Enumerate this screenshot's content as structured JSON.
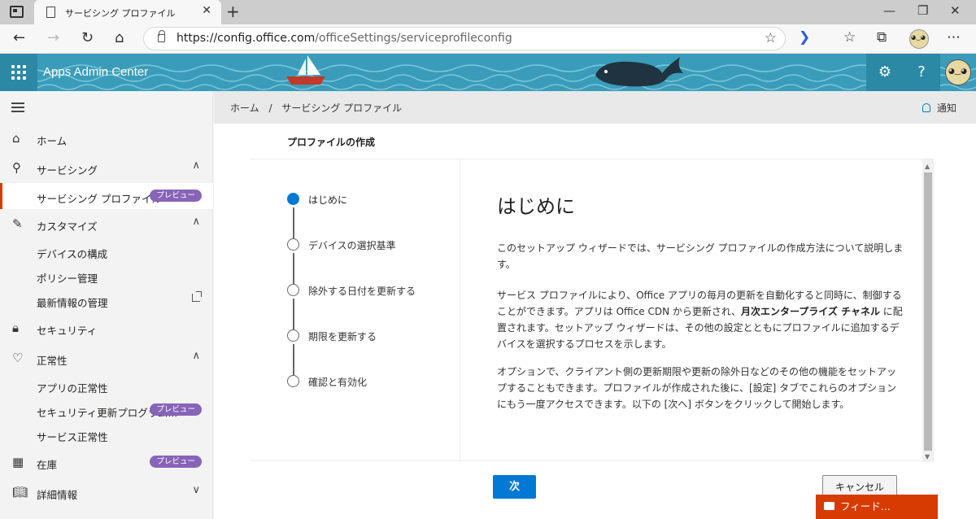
{
  "browser": {
    "tab_title": "サービシング プロファイル",
    "tab_close": "✕",
    "new_tab": "+",
    "url_host": "https://config.office.com",
    "url_path": "/officeSettings/serviceprofileconfig",
    "controls": {
      "minimize": "—",
      "maximize": "❐",
      "close": "✕"
    }
  },
  "header": {
    "app_title": "Apps Admin Center",
    "settings_icon": "⚙",
    "help_icon": "?"
  },
  "sidebar": {
    "items": [
      {
        "label": "ホーム",
        "icon": "⌂"
      },
      {
        "label": "サービシング",
        "icon": "⚲",
        "chevron": "∧"
      },
      {
        "label": "サービシング プロファイル",
        "badge": "プレビュー"
      },
      {
        "label": "カスタマイズ",
        "icon": "✎",
        "chevron": "∧"
      },
      {
        "label": "デバイスの構成"
      },
      {
        "label": "ポリシー管理"
      },
      {
        "label": "最新情報の管理"
      },
      {
        "label": "セキュリティ",
        "icon": "🔒︎"
      },
      {
        "label": "正常性",
        "icon": "♡",
        "chevron": "∧"
      },
      {
        "label": "アプリの正常性"
      },
      {
        "label": "セキュリティ更新プログラム...",
        "badge": "プレビュー"
      },
      {
        "label": "サービス正常性"
      },
      {
        "label": "在庫",
        "icon": "▦",
        "badge": "プレビュー"
      },
      {
        "label": "詳細情報",
        "icon": "📖︎",
        "chevron": "∨"
      }
    ]
  },
  "breadcrumb": {
    "home": "ホーム",
    "separator": "/",
    "current": "サービシング プロファイル"
  },
  "notifications": "通知",
  "page": {
    "subtitle": "プロファイルの作成",
    "steps": [
      {
        "label": "はじめに",
        "active": true
      },
      {
        "label": "デバイスの選択基準",
        "active": false
      },
      {
        "label": "除外する日付を更新する",
        "active": false
      },
      {
        "label": "期限を更新する",
        "active": false
      },
      {
        "label": "確認と有効化",
        "active": false
      }
    ],
    "heading": "はじめに",
    "para1": "このセットアップ ウィザードでは、サービシング プロファイルの作成方法について説明します。",
    "para2_a": "サービス プロファイルにより、Office アプリの毎月の更新を自動化すると同時に、制御することができます。アプリは Office CDN から更新され、",
    "para2_bold": "月次エンタープライズ チャネル",
    "para2_b": " に配置されます。セットアップ ウィザードは、その他の設定とともにプロファイルに追加するデバイスを選択するプロセスを示します。",
    "para3": "オプションで、クライアント側の更新期限や更新の除外日などのその他の機能をセットアップすることもできます。プロファイルが作成された後に、[設定] タブでこれらのオプションにもう一度アクセスできます。以下の [次へ] ボタンをクリックして開始します。"
  },
  "buttons": {
    "next": "次",
    "cancel": "キャンセル",
    "feedback": "フィード..."
  }
}
